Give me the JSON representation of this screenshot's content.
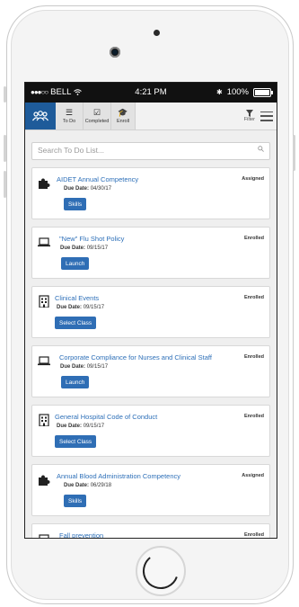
{
  "status_bar": {
    "carrier": "BELL",
    "time": "4:21 PM",
    "battery": "100%"
  },
  "nav": {
    "tabs": [
      {
        "label": "To Do",
        "icon": "list-icon"
      },
      {
        "label": "Completed",
        "icon": "checkbox-icon"
      },
      {
        "label": "Enroll",
        "icon": "graduation-cap-icon"
      }
    ],
    "filter_label": "Filter"
  },
  "search": {
    "placeholder": "Search To Do List..."
  },
  "items": [
    {
      "title": "AIDET Annual Competency",
      "status": "Assigned",
      "due_label": "Due Date:",
      "due_date": "04/30/17",
      "button": "Skills",
      "icon": "puzzle-icon"
    },
    {
      "title": "\"New\" Flu Shot Policy",
      "status": "Enrolled",
      "due_label": "Due Date:",
      "due_date": "09/15/17",
      "button": "Launch",
      "icon": "laptop-icon"
    },
    {
      "title": "Clinical Events",
      "status": "Enrolled",
      "due_label": "Due Date:",
      "due_date": "09/15/17",
      "button": "Select Class",
      "icon": "building-icon"
    },
    {
      "title": "Corporate Compliance for Nurses and Clinical Staff",
      "status": "Enrolled",
      "due_label": "Due Date:",
      "due_date": "09/15/17",
      "button": "Launch",
      "icon": "laptop-icon"
    },
    {
      "title": "General Hospital Code of Conduct",
      "status": "Enrolled",
      "due_label": "Due Date:",
      "due_date": "09/15/17",
      "button": "Select Class",
      "icon": "building-icon"
    },
    {
      "title": "Annual Blood Administration Competency",
      "status": "Assigned",
      "due_label": "Due Date:",
      "due_date": "06/29/18",
      "button": "Skills",
      "icon": "puzzle-icon"
    },
    {
      "title": "Fall prevention",
      "status": "Enrolled",
      "icon": "laptop-icon"
    }
  ],
  "colors": {
    "accent": "#2f6eb5",
    "logo_bg": "#1e5b9a",
    "title": "#2d6fb8"
  }
}
